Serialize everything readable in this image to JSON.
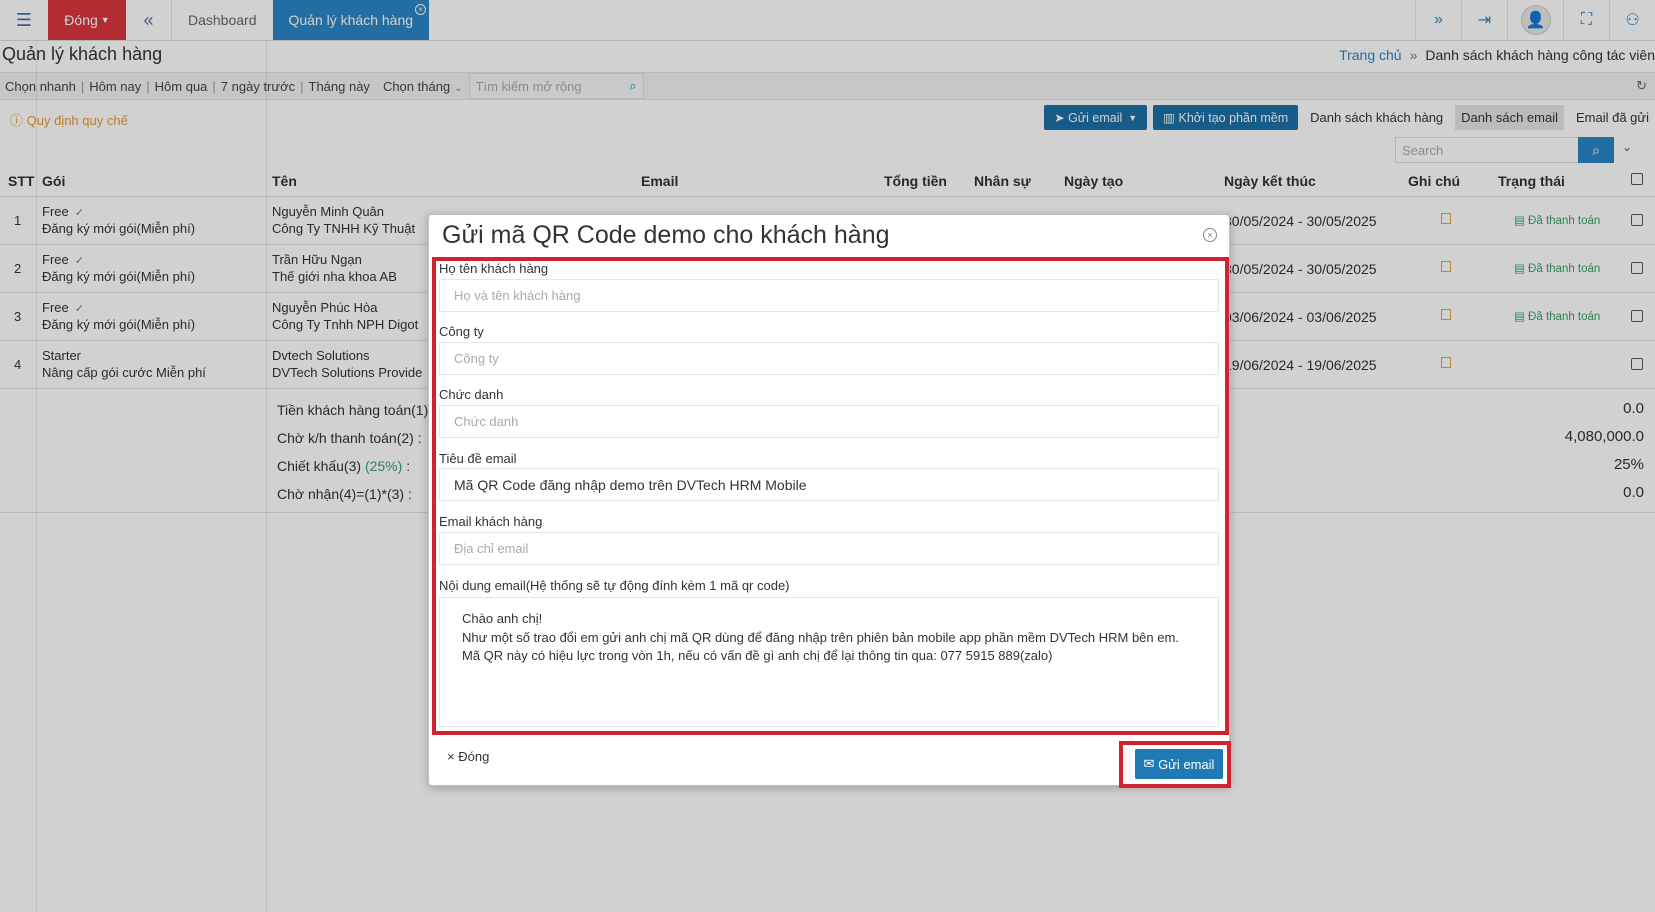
{
  "topbar": {
    "menu_icon": "hamburger-icon",
    "close_label": "Đóng",
    "tabs": [
      {
        "label": "Dashboard"
      },
      {
        "label": "Quản lý khách hàng"
      }
    ]
  },
  "page": {
    "title": "Quản lý khách hàng",
    "breadcrumb_home": "Trang chủ",
    "breadcrumb_sep": "»",
    "breadcrumb_current": "Danh sách khách hàng công tác viên"
  },
  "filters": {
    "quick": [
      "Chọn nhanh",
      "Hôm nay",
      "Hôm qua",
      "7 ngày trước",
      "Tháng này"
    ],
    "month": "Chọn tháng",
    "search_placeholder": "Tìm kiếm mở rộng"
  },
  "actions": {
    "rules_link": "Quy định quy chế",
    "send_email": "Gửi email",
    "init_software": "Khởi tạo phần mềm",
    "tab_customers": "Danh sách khách hàng",
    "tab_emails": "Danh sách email",
    "tab_sent": "Email đã gửi",
    "table_search_placeholder": "Search"
  },
  "table": {
    "headers": [
      "STT",
      "Gói",
      "Tên",
      "Email",
      "Tổng tiền",
      "Nhân sự",
      "Ngày tạo",
      "Ngày kết thúc",
      "Ghi chú",
      "Trạng thái"
    ],
    "rows": [
      {
        "stt": "1",
        "pkg": "Free",
        "pkg_sub": "Đăng ký mới gói(Miễn phí)",
        "name": "Nguyễn Minh Quân",
        "company": "Công Ty TNHH Kỹ Thuật",
        "period": "30/05/2024 - 30/05/2025",
        "status": "Đã thanh toán"
      },
      {
        "stt": "2",
        "pkg": "Free",
        "pkg_sub": "Đăng ký mới gói(Miễn phí)",
        "name": "Trần Hữu Ngạn",
        "company": "Thế giới nha khoa AB",
        "period": "30/05/2024 - 30/05/2025",
        "status": "Đã thanh toán"
      },
      {
        "stt": "3",
        "pkg": "Free",
        "pkg_sub": "Đăng ký mới gói(Miễn phí)",
        "name": "Nguyễn Phúc Hòa",
        "company": "Công Ty Tnhh NPH Digot",
        "period": "03/06/2024 - 03/06/2025",
        "status": "Đã thanh toán"
      },
      {
        "stt": "4",
        "pkg": "Starter",
        "pkg_sub": "Nâng cấp gói cước Miễn phí",
        "name": "Dvtech Solutions",
        "company": "DVTech Solutions Provide",
        "period": "19/06/2024 - 19/06/2025",
        "status": ""
      }
    ]
  },
  "totals": {
    "paid_label": "Tiền khách hàng toán(1)",
    "waiting_label": "Chờ k/h thanh toán(2) :",
    "discount_label": "Chiết khấu(3)",
    "discount_pct": "(25%)",
    "discount_colon": ":",
    "receive_label": "Chờ nhận(4)=(1)*(3) :",
    "paid_value": "0.0",
    "waiting_value": "4,080,000.0",
    "discount_value": "25%",
    "receive_value": "0.0"
  },
  "modal": {
    "title": "Gửi mã QR Code demo cho khách hàng",
    "fields": {
      "name_label": "Họ tên khách hàng",
      "name_placeholder": "Họ và tên khách hàng",
      "company_label": "Công ty",
      "company_placeholder": "Công ty",
      "position_label": "Chức danh",
      "position_placeholder": "Chức danh",
      "subject_label": "Tiêu đề email",
      "subject_value": "Mã QR Code đăng nhập demo trên DVTech HRM Mobile",
      "email_label": "Email khách hàng",
      "email_placeholder": "Địa chỉ email",
      "body_label": "Nội dung email(Hệ thống sẽ tự động đính kèm 1 mã qr code)",
      "body_line1": "Chào anh chị!",
      "body_line2": "Như một số trao đổi em gửi anh chị mã QR dùng để đăng nhập trên phiên bản mobile app phần mềm DVTech HRM bên em.",
      "body_line3": "Mã QR này có hiệu lực trong vòn 1h, nếu có vấn đề gì anh chị để lại thông tin qua: 077 5915 889(zalo)"
    },
    "close_label": "Đóng",
    "send_label": "Gửi email"
  },
  "colors": {
    "accent": "#2a87c6",
    "danger": "#d9363e",
    "highlight": "#d1232f",
    "success": "#3aa06b"
  }
}
